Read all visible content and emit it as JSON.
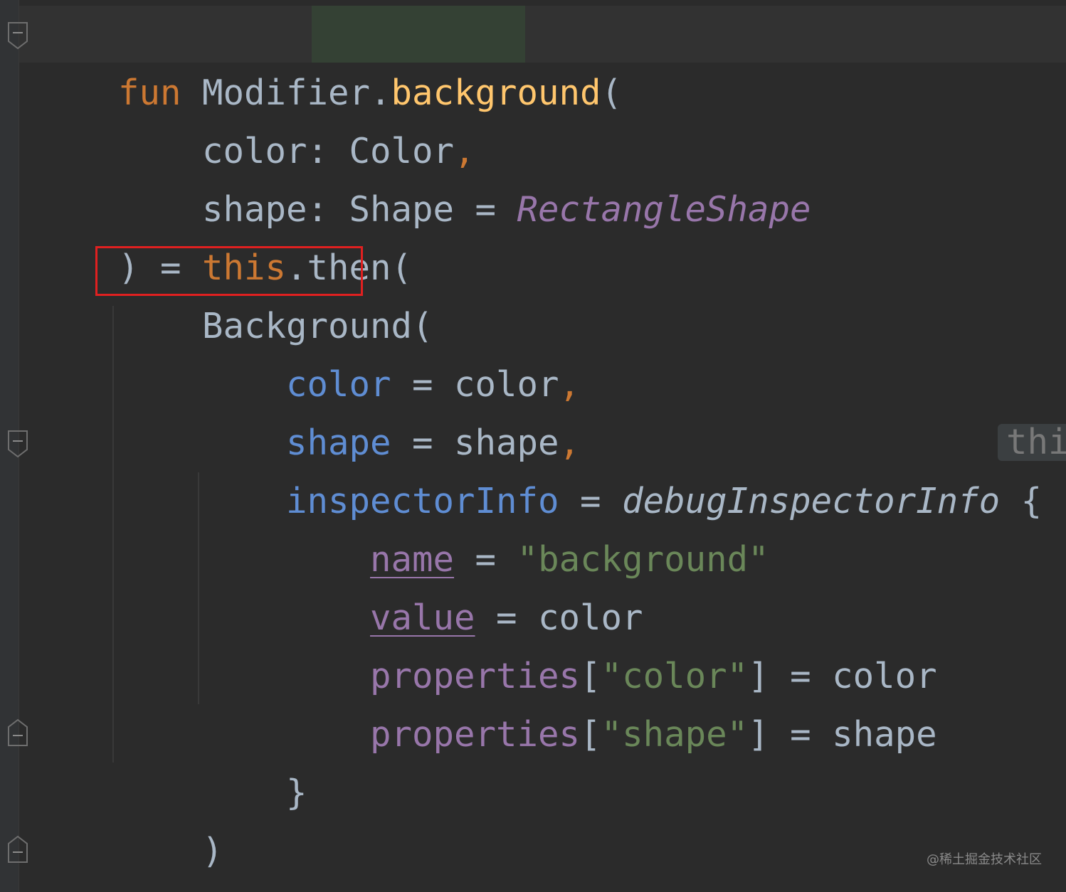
{
  "code": {
    "line1": {
      "kw_fun": "fun",
      "receiver": " Modifier.",
      "fn_name": "background",
      "open": "("
    },
    "line2": {
      "indent": "    ",
      "text": "color: Color",
      "comma": ","
    },
    "line3": {
      "indent": "    ",
      "text": "shape: Shape = ",
      "default": "RectangleShape"
    },
    "line4": {
      "start": ") = ",
      "kw_this": "this",
      "rest": ".then("
    },
    "line5": {
      "indent": "    ",
      "text": "Background("
    },
    "line6": {
      "indent": "        ",
      "param": "color",
      "eq": " = color",
      "comma": ","
    },
    "line7": {
      "indent": "        ",
      "param": "shape",
      "eq": " = shape",
      "comma": ","
    },
    "line8": {
      "indent": "        ",
      "param": "inspectorInfo",
      "eq": " = ",
      "call": "debugInspectorInfo",
      "brace": " {"
    },
    "line9": {
      "indent": "            ",
      "prop": "name",
      "eq": " = ",
      "str": "\"background\""
    },
    "line10": {
      "indent": "            ",
      "prop": "value",
      "eq": " = color"
    },
    "line11": {
      "indent": "            ",
      "prop": "properties",
      "open": "[",
      "str": "\"color\"",
      "close": "] = color"
    },
    "line12": {
      "indent": "            ",
      "prop": "properties",
      "open": "[",
      "str": "\"shape\"",
      "close": "] = shape"
    },
    "line13": {
      "indent": "        ",
      "text": "}"
    },
    "line14": {
      "indent": "    ",
      "text": ")"
    },
    "line15": {
      "text": ")"
    }
  },
  "inlay_hint": "thi",
  "watermark": "@稀土掘金技术社区",
  "colors": {
    "background": "#2b2b2b",
    "keyword": "#cc7832",
    "function": "#ffc66d",
    "parameter": "#5f8dd3",
    "property": "#9876aa",
    "string": "#6a8759",
    "default_text": "#a9b7c6",
    "highlight_box": "#e02020"
  }
}
